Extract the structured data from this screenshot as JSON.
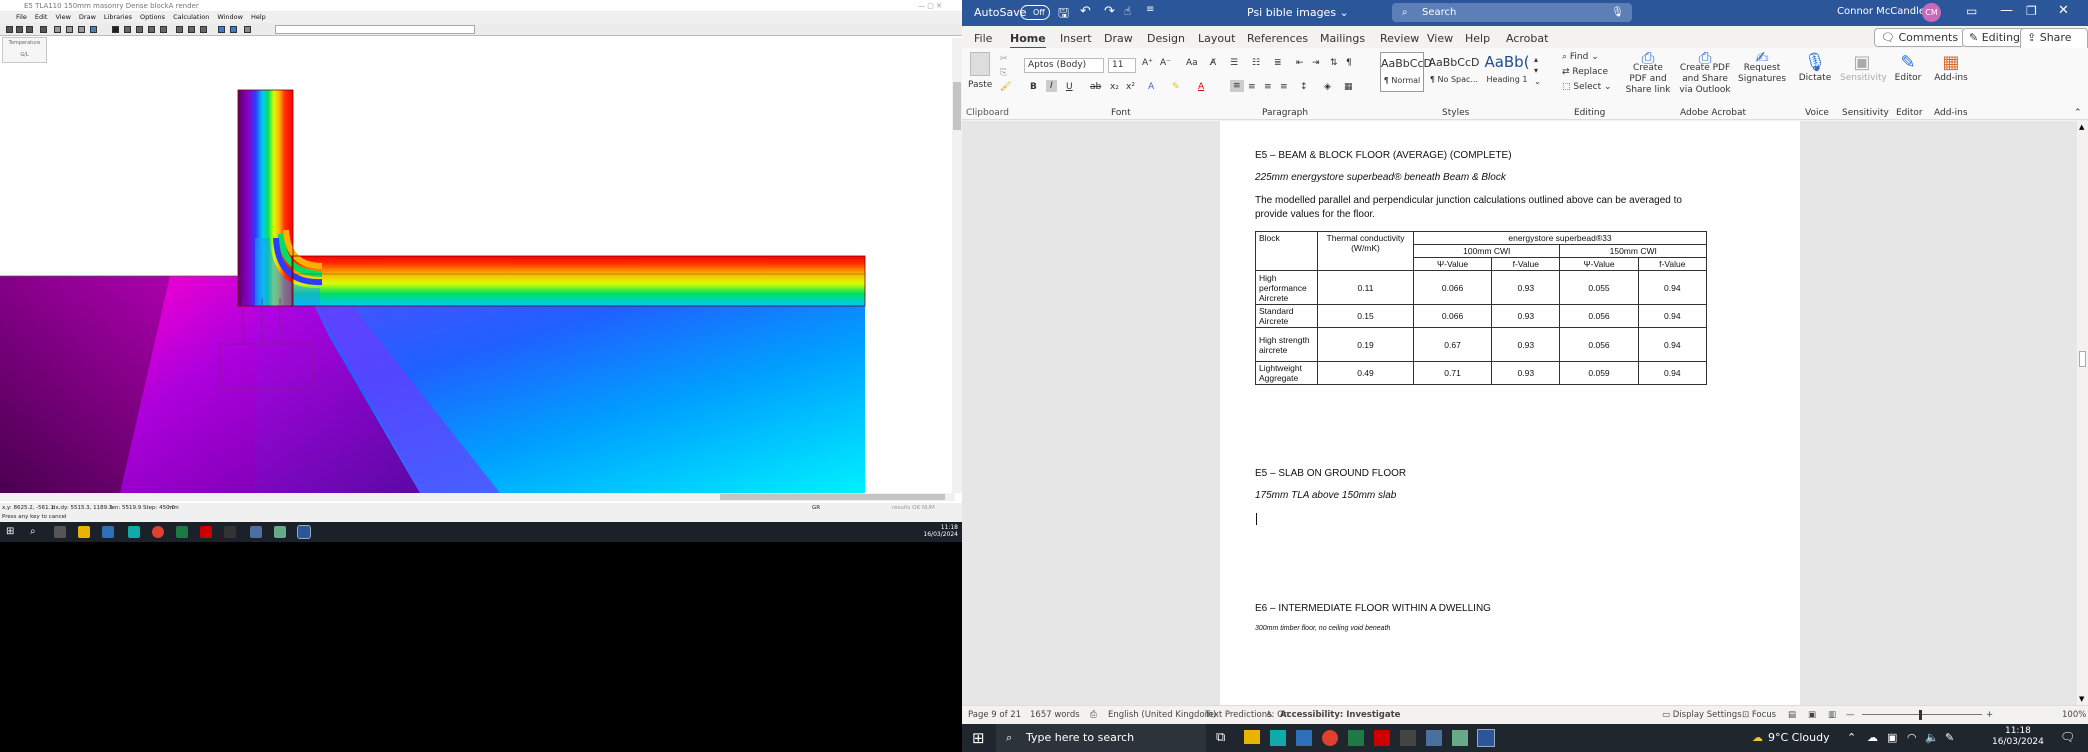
{
  "left_app": {
    "title": "E5 TLA110 150mm masonry Dense blockA render",
    "menu": [
      "File",
      "Edit",
      "View",
      "Draw",
      "Libraries",
      "Options",
      "Calculation",
      "Window",
      "Help"
    ],
    "temp_panel_label": "Temperature",
    "temp_panel_value": "G/L",
    "status_coords": "x,y: 8625.2, -561.1",
    "status_dxdy": "dx,dy: 5515.3, 1189.3",
    "status_len": "len: 5519.9   Step: 450.0",
    "status_units": "mm",
    "status_center": "GR",
    "status_right": "results OK  NUM",
    "status_hint": "Press any key to cancel",
    "taskbar_time": "11:18",
    "taskbar_date": "16/03/2024"
  },
  "word": {
    "autosave_label": "AutoSave",
    "autosave_state": "Off",
    "doc_title": "Psi bible images",
    "search_placeholder": "Search",
    "user_name": "Connor McCandless",
    "user_initials": "CM",
    "tabs": [
      "File",
      "Home",
      "Insert",
      "Draw",
      "Design",
      "Layout",
      "References",
      "Mailings",
      "Review",
      "View",
      "Help",
      "Acrobat"
    ],
    "comments_label": "Comments",
    "editing_label": "Editing",
    "share_label": "Share",
    "ribbon": {
      "paste": "Paste",
      "clipboard": "Clipboard",
      "font_name": "Aptos (Body)",
      "font_size": "11",
      "font_group": "Font",
      "paragraph_group": "Paragraph",
      "styles_group": "Styles",
      "styles": [
        {
          "preview": "AaBbCcD",
          "name": "¶ Normal"
        },
        {
          "preview": "AaBbCcD",
          "name": "¶ No Spac..."
        },
        {
          "preview": "AaBb(",
          "name": "Heading 1"
        }
      ],
      "find": "Find",
      "replace": "Replace",
      "select": "Select",
      "editing_group": "Editing",
      "create_pdf_share": "Create PDF and Share link",
      "create_pdf_outlook": "Create PDF and Share via Outlook",
      "request_signatures": "Request Signatures",
      "adobe_group": "Adobe Acrobat",
      "dictate": "Dictate",
      "voice_group": "Voice",
      "sensitivity": "Sensitivity",
      "sensitivity_group": "Sensitivity",
      "editor": "Editor",
      "editor_group": "Editor",
      "addins": "Add-ins",
      "addins_group": "Add-ins"
    },
    "doc": {
      "h1": "E5 – BEAM & BLOCK FLOOR (AVERAGE) (COMPLETE)",
      "sub1": "225mm energystore superbead® beneath Beam & Block",
      "para1": "The modelled parallel and perpendicular junction calculations outlined above can be averaged to provide values for the floor.",
      "table": {
        "h_block": "Block",
        "h_tc": "Thermal conductivity (W/mK)",
        "h_product": "energystore superbead®33",
        "h_100": "100mm CWI",
        "h_150": "150mm CWI",
        "h_psi": "Ψ-Value",
        "h_f": "f-Value",
        "rows": [
          {
            "block": "High performance Aircrete",
            "tc": "0.11",
            "psi100": "0.066",
            "f100": "0.93",
            "psi150": "0.055",
            "f150": "0.94"
          },
          {
            "block": "Standard Aircrete",
            "tc": "0.15",
            "psi100": "0.066",
            "f100": "0.93",
            "psi150": "0.056",
            "f150": "0.94"
          },
          {
            "block": "High strength aircrete",
            "tc": "0.19",
            "psi100": "0.67",
            "f100": "0.93",
            "psi150": "0.056",
            "f150": "0.94"
          },
          {
            "block": "Lightweight Aggregate",
            "tc": "0.49",
            "psi100": "0.71",
            "f100": "0.93",
            "psi150": "0.059",
            "f150": "0.94"
          }
        ]
      },
      "h2": "E5 – SLAB ON GROUND FLOOR",
      "sub2": "175mm TLA above 150mm slab",
      "h3": "E6 – INTERMEDIATE FLOOR WITHIN A DWELLING",
      "sub3": "300mm timber floor, no ceiling void beneath"
    },
    "status": {
      "page": "Page 9 of 21",
      "words": "1657 words",
      "language": "English (United Kingdom)",
      "predictions": "Text Predictions: On",
      "accessibility": "Accessibility: Investigate",
      "display_settings": "Display Settings",
      "focus": "Focus",
      "zoom": "100%"
    },
    "taskbar": {
      "search_placeholder": "Type here to search",
      "weather": "9°C  Cloudy",
      "time": "11:18",
      "date": "16/03/2024"
    }
  }
}
